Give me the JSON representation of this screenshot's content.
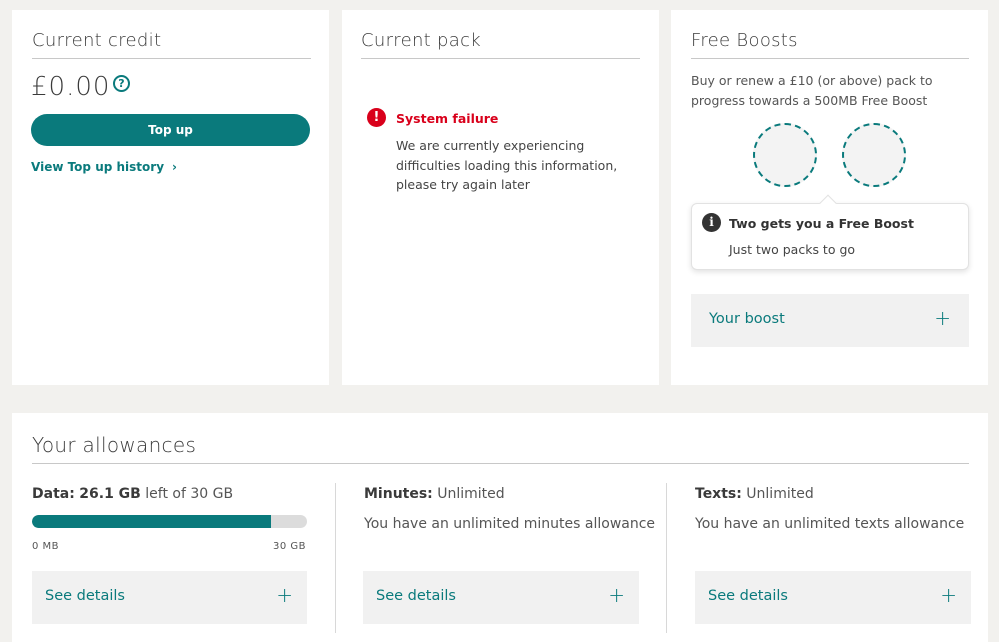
{
  "credit": {
    "title": "Current credit",
    "balance": "£0.00",
    "help_glyph": "?",
    "topup_label": "Top up",
    "history_label": "View Top up history",
    "history_chevron": "›"
  },
  "pack": {
    "title": "Current pack",
    "error_glyph": "!",
    "error_title": "System failure",
    "error_message": "We are currently experiencing difficulties loading this information, please try again later"
  },
  "boosts": {
    "title": "Free Boosts",
    "description": "Buy or renew a £10 (or above) pack to progress towards a 500MB Free Boost",
    "tooltip_glyph": "i",
    "tooltip_title": "Two gets you a Free Boost",
    "tooltip_body": "Just two packs to go",
    "your_boost_label": "Your boost",
    "plus_glyph": "+"
  },
  "allowances": {
    "title": "Your allowances",
    "data": {
      "label": "Data:",
      "used_value": "26.1 GB",
      "suffix": "left of 30 GB",
      "fill_fraction": 0.87,
      "min_label": "0 MB",
      "max_label": "30 GB",
      "details_label": "See details"
    },
    "minutes": {
      "label": "Minutes:",
      "value": "Unlimited",
      "description": "You have an unlimited minutes allowance",
      "details_label": "See details"
    },
    "texts": {
      "label": "Texts:",
      "value": "Unlimited",
      "description": "You have an unlimited texts allowance",
      "details_label": "See details"
    },
    "plus_glyph": "+"
  },
  "colors": {
    "accent": "#0a7a7c",
    "error": "#d9001b",
    "background": "#f2f1ee"
  },
  "icons": [
    "help-circle-icon",
    "chevron-right-icon",
    "error-circle-icon",
    "info-circle-icon",
    "plus-icon"
  ]
}
